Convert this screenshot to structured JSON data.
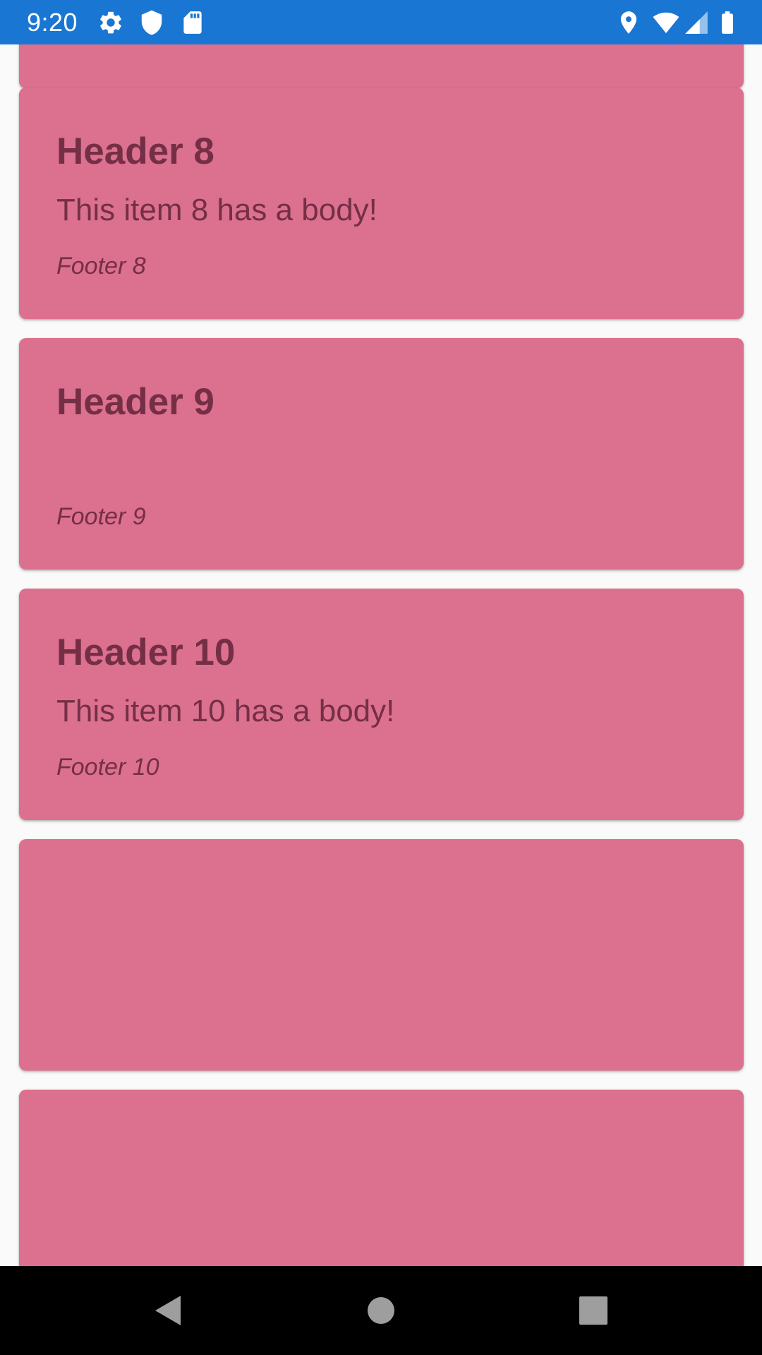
{
  "status_bar": {
    "time": "9:20",
    "background": "#1976d2",
    "left_icons": [
      "gear-icon",
      "shield-icon",
      "sd-card-icon"
    ],
    "right_icons": [
      "location-icon",
      "wifi-icon",
      "signal-icon",
      "battery-icon"
    ]
  },
  "cards": [
    {
      "header": "",
      "body": "",
      "footer": ""
    },
    {
      "header": "Header 8",
      "body": "This item 8 has a body!",
      "footer": "Footer 8"
    },
    {
      "header": "Header 9",
      "body": "",
      "footer": "Footer 9"
    },
    {
      "header": "Header 10",
      "body": "This item 10 has a body!",
      "footer": "Footer 10"
    },
    {
      "header": "",
      "body": "",
      "footer": ""
    },
    {
      "header": "",
      "body": "",
      "footer": ""
    }
  ],
  "colors": {
    "card_background": "#dc708f",
    "card_text": "#742f46",
    "page_background": "#fafafa",
    "nav_bar": "#000000"
  },
  "nav_bar": {
    "buttons": [
      "back-icon",
      "home-icon",
      "recents-icon"
    ]
  }
}
